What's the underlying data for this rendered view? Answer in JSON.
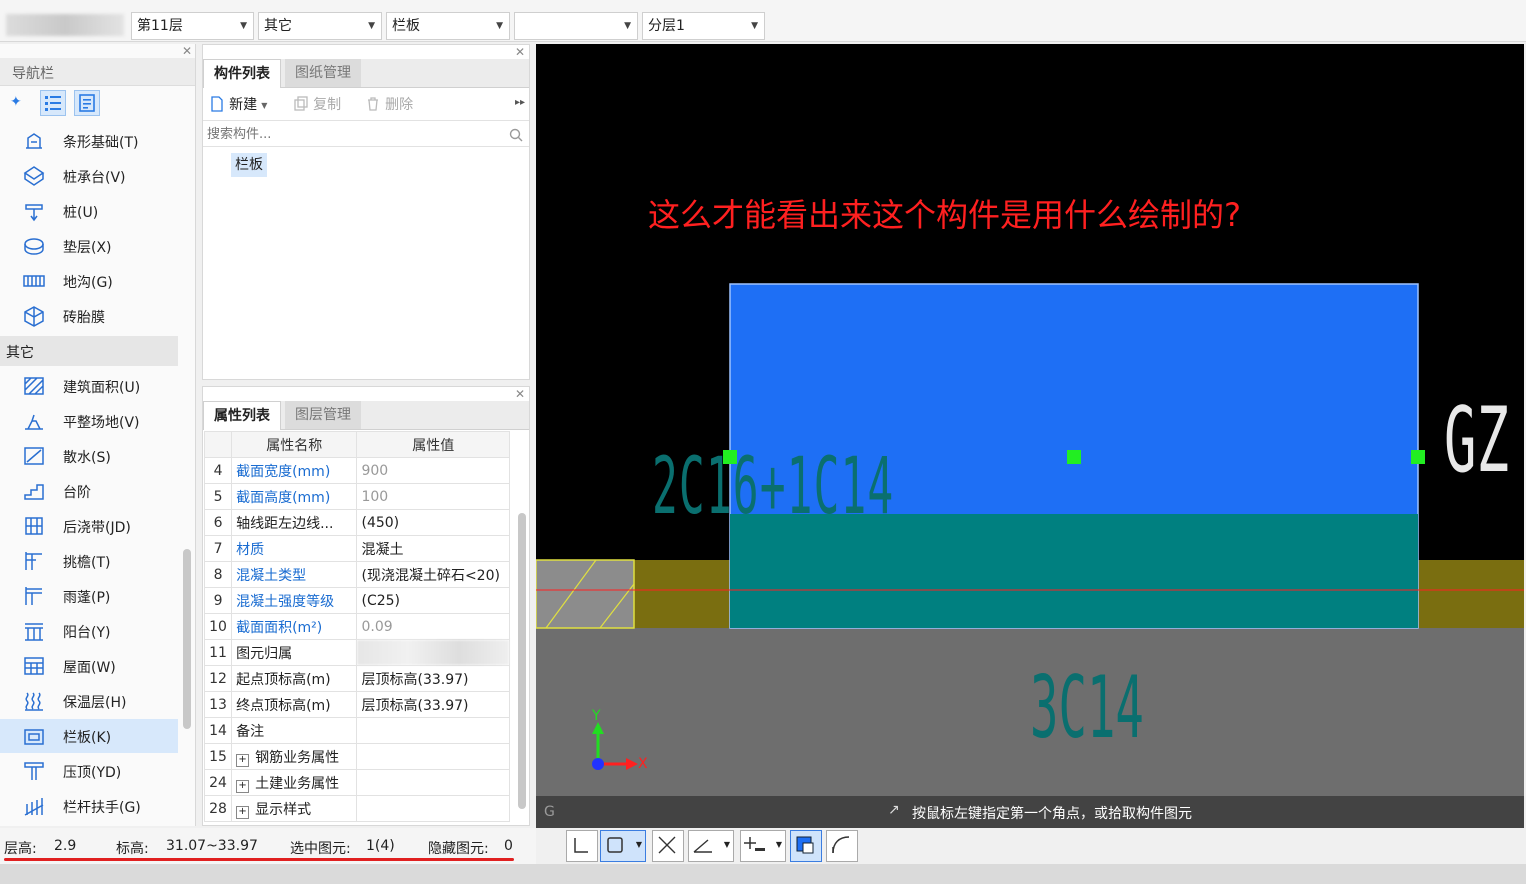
{
  "toolbar": {
    "floor": "第11层",
    "category": "其它",
    "type": "栏板",
    "component": "",
    "layer": "分层1"
  },
  "nav": {
    "title": "导航栏",
    "group_label": "其它",
    "items_top": [
      {
        "label": "条形基础(T)",
        "icon": "strip-foundation-icon"
      },
      {
        "label": "桩承台(V)",
        "icon": "pile-cap-icon"
      },
      {
        "label": "桩(U)",
        "icon": "pile-icon"
      },
      {
        "label": "垫层(X)",
        "icon": "cushion-icon"
      },
      {
        "label": "地沟(G)",
        "icon": "trench-icon"
      },
      {
        "label": "砖胎膜",
        "icon": "brick-mold-icon"
      }
    ],
    "items_other": [
      {
        "label": "建筑面积(U)",
        "icon": "building-area-icon"
      },
      {
        "label": "平整场地(V)",
        "icon": "site-leveling-icon"
      },
      {
        "label": "散水(S)",
        "icon": "apron-icon"
      },
      {
        "label": "台阶",
        "icon": "steps-icon"
      },
      {
        "label": "后浇带(JD)",
        "icon": "post-pour-strip-icon"
      },
      {
        "label": "挑檐(T)",
        "icon": "cornice-icon"
      },
      {
        "label": "雨蓬(P)",
        "icon": "canopy-icon"
      },
      {
        "label": "阳台(Y)",
        "icon": "balcony-icon"
      },
      {
        "label": "屋面(W)",
        "icon": "roof-icon"
      },
      {
        "label": "保温层(H)",
        "icon": "insulation-icon"
      },
      {
        "label": "栏板(K)",
        "icon": "parapet-icon",
        "selected": true
      },
      {
        "label": "压顶(YD)",
        "icon": "coping-icon"
      },
      {
        "label": "栏杆扶手(G)",
        "icon": "railing-icon"
      }
    ]
  },
  "component_panel": {
    "tab_active": "构件列表",
    "tab_inactive": "图纸管理",
    "new_label": "新建",
    "copy_label": "复制",
    "delete_label": "删除",
    "search_placeholder": "搜索构件...",
    "items": [
      "栏板"
    ]
  },
  "property_panel": {
    "tab_active": "属性列表",
    "tab_inactive": "图层管理",
    "col_name": "属性名称",
    "col_value": "属性值",
    "rows": [
      {
        "no": "4",
        "name": "截面宽度(mm)",
        "value": "900",
        "name_blue": true,
        "value_gray": true
      },
      {
        "no": "5",
        "name": "截面高度(mm)",
        "value": "100",
        "name_blue": true,
        "value_gray": true
      },
      {
        "no": "6",
        "name": "轴线距左边线...",
        "value": "(450)"
      },
      {
        "no": "7",
        "name": "材质",
        "value": "混凝土",
        "name_blue": true
      },
      {
        "no": "8",
        "name": "混凝土类型",
        "value": "(现浇混凝土碎石<20)",
        "name_blue": true
      },
      {
        "no": "9",
        "name": "混凝土强度等级",
        "value": "(C25)",
        "name_blue": true
      },
      {
        "no": "10",
        "name": "截面面积(m²)",
        "value": "0.09",
        "name_blue": true,
        "value_gray": true
      },
      {
        "no": "11",
        "name": "图元归属",
        "value": ""
      },
      {
        "no": "12",
        "name": "起点顶标高(m)",
        "value": "层顶标高(33.97)"
      },
      {
        "no": "13",
        "name": "终点顶标高(m)",
        "value": "层顶标高(33.97)"
      },
      {
        "no": "14",
        "name": "备注",
        "value": ""
      },
      {
        "no": "15",
        "name": "钢筋业务属性",
        "value": "",
        "expand": true
      },
      {
        "no": "24",
        "name": "土建业务属性",
        "value": "",
        "expand": true
      },
      {
        "no": "28",
        "name": "显示样式",
        "value": "",
        "expand": true
      }
    ]
  },
  "canvas": {
    "annotation": "这么才能看出来这个构件是用什么绘制的?",
    "rebar_label_top": "2C16+1C14",
    "rebar_label_bottom": "3C14",
    "side_label": "GZ",
    "axis_x": "X",
    "axis_y": "Y",
    "hint": "按鼠标左键指定第一个角点，或拾取构件图元",
    "corner_letter": "G",
    "colors": {
      "background": "#000000",
      "slab": "#1e6ff5",
      "teal": "#008080",
      "olive": "#7a6e10",
      "gray_band": "#6e6e6e",
      "grip": "#22ee22",
      "annotation": "#ff2020"
    }
  },
  "status": {
    "floor_height_label": "层高:",
    "floor_height": "2.9",
    "elevation_label": "标高:",
    "elevation": "31.07~33.97",
    "selected_label": "选中图元:",
    "selected": "1(4)",
    "hidden_label": "隐藏图元:",
    "hidden": "0"
  }
}
